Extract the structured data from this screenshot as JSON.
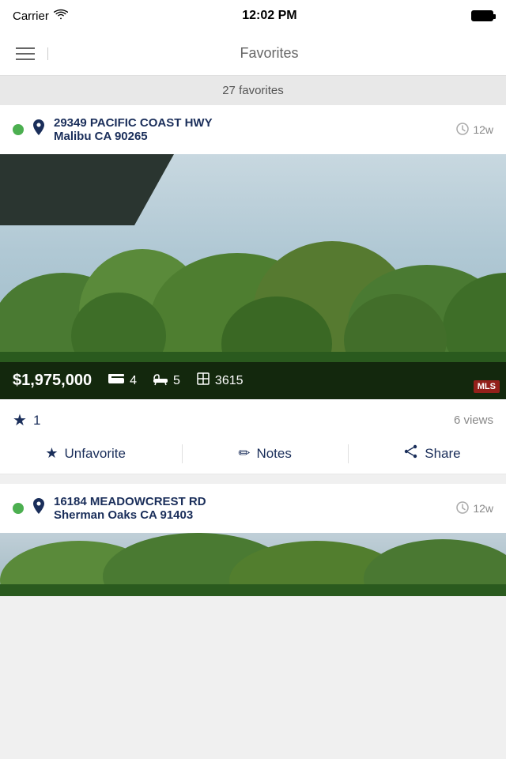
{
  "statusBar": {
    "carrier": "Carrier",
    "wifi": "wifi",
    "time": "12:02 PM",
    "battery": "full"
  },
  "header": {
    "menuIcon": "menu",
    "title": "Favorites"
  },
  "countBar": {
    "label": "27 favorites"
  },
  "listing1": {
    "statusDot": "active",
    "addressLine1": "29349 PACIFIC COAST HWY",
    "addressLine2": "Malibu CA 90265",
    "timeAgo": "12w",
    "price": "$1,975,000",
    "beds": "4",
    "baths": "5",
    "sqft": "3615",
    "favoriteCount": "1",
    "views": "6 views",
    "unfavoriteLabel": "Unfavorite",
    "notesLabel": "Notes",
    "shareLabel": "Share"
  },
  "listing2": {
    "statusDot": "active",
    "addressLine1": "16184 MEADOWCREST RD",
    "addressLine2": "Sherman Oaks CA 91403",
    "timeAgo": "12w"
  },
  "colors": {
    "darkBlue": "#1a2e5a",
    "green": "#4caf50",
    "lightGray": "#e8e8e8"
  }
}
